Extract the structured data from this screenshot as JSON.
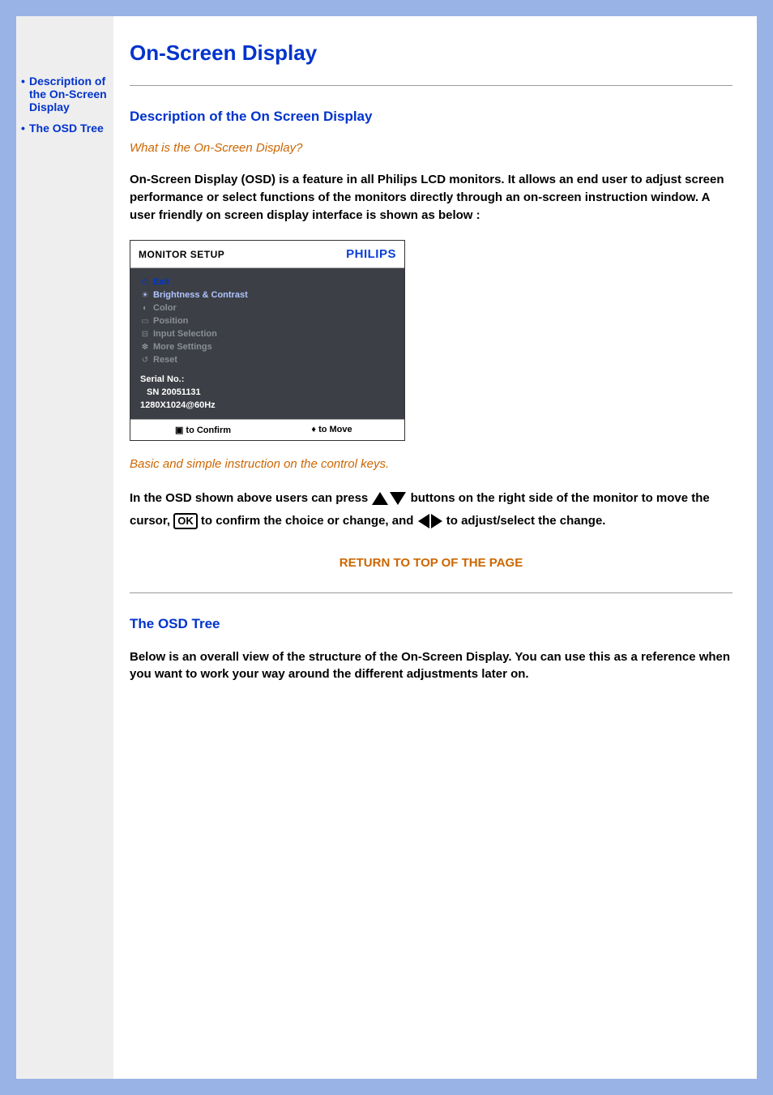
{
  "sidebar": {
    "items": [
      {
        "label": "Description of the On-Screen Display"
      },
      {
        "label": "The OSD Tree"
      }
    ]
  },
  "page": {
    "title": "On-Screen Display"
  },
  "section1": {
    "heading": "Description of the On Screen Display",
    "question": "What is the On-Screen Display?",
    "intro": "On-Screen Display (OSD) is a feature in all Philips LCD monitors. It allows an end user to adjust screen performance or select functions of the monitors directly through an on-screen instruction window. A user friendly on screen display interface is shown as below :",
    "caption": "Basic and simple instruction on the control keys.",
    "instr_pre": "In the OSD shown above users can press ",
    "instr_mid1": " buttons on the right side of the monitor to move the cursor,",
    "instr_mid2": " to confirm the choice or change, and ",
    "instr_post": " to adjust/select the change.",
    "ok_label": "OK"
  },
  "osd": {
    "header_title": "MONITOR SETUP",
    "brand": "PHILIPS",
    "menu": {
      "exit": "Exit",
      "brightness": "Brightness & Contrast",
      "color": "Color",
      "position": "Position",
      "input": "Input Selection",
      "more": "More Settings",
      "reset": "Reset"
    },
    "serial_label": "Serial No.:",
    "serial_value": "SN 20051131",
    "resolution": "1280X1024@60Hz",
    "footer_confirm": "to Confirm",
    "footer_confirm_icon": "▣",
    "footer_move": "to Move",
    "footer_move_icon": "♦"
  },
  "return_link": "RETURN TO TOP OF THE PAGE",
  "section2": {
    "heading": "The OSD Tree",
    "body": "Below is an overall view of the structure of the On-Screen Display. You can use this as a reference when you want to work your way around the different adjustments later on."
  }
}
